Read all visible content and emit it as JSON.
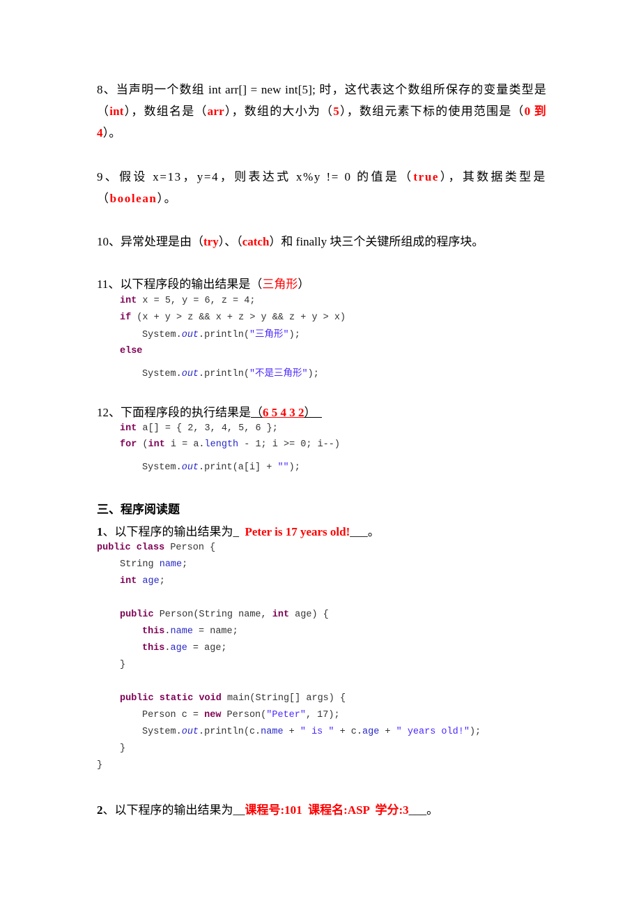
{
  "colors": {
    "answer": "#ff0000",
    "keyword": "#7f0055",
    "field": "#0000c0",
    "string": "#2a00ff"
  },
  "q8": {
    "text1": "8、当声明一个数组 int arr[] = new int[5]; 时，这代表这个数组所保存的变量类型是（",
    "ans1": "int",
    "text2": "），数组名是（",
    "ans2": "arr",
    "text3": "），数组的大小为（",
    "ans3": "5",
    "text4": "），数组元素下标的使用范围是（",
    "ans4": "0 到 4",
    "text5": "）。"
  },
  "q9": {
    "text1": "9、假设 x=13，y=4，则表达式 x%y != 0 的值是（",
    "ans1": "true",
    "text2": "），其数据类型是（",
    "ans2": "boolean",
    "text3": "）。"
  },
  "q10": {
    "text1": "10、异常处理是由（",
    "ans1": "try",
    "text2": "）、（",
    "ans2": "catch",
    "text3": "）和 finally 块三个关键所组成的程序块。"
  },
  "q11": {
    "text1": "11、以下程序段的输出结果是（",
    "ans1": "三角形",
    "text2": "）",
    "code": {
      "l1_kw": "int",
      "l1_rest": " x = 5, y = 6, z = 4;",
      "l2_kw": "if",
      "l2_rest": " (x + y > z && x + z > y && z + y > x)",
      "l3_a": "System.",
      "l3_out": "out",
      "l3_b": ".println(",
      "l3_str": "\"三角形\"",
      "l3_c": ");",
      "l4_kw": "else",
      "l5_a": "System.",
      "l5_out": "out",
      "l5_b": ".println(",
      "l5_str": "\"不是三角形\"",
      "l5_c": ");"
    }
  },
  "q12": {
    "text1": "12、下面程序段的执行结果是",
    "paren_open": "（",
    "ans1": "6 5 4 3 2",
    "paren_close": "）",
    "code": {
      "l1_kw": "int",
      "l1_rest": " a[] = { 2, 3, 4, 5, 6 };",
      "l2_kw1": "for",
      "l2_a": " (",
      "l2_kw2": "int",
      "l2_b": " i = a.",
      "l2_fld": "length",
      "l2_c": " - 1; i >= 0; i--)",
      "l3_a": "System.",
      "l3_out": "out",
      "l3_b": ".print(a[i] + ",
      "l3_str": "\"\"",
      "l3_c": ");"
    }
  },
  "section3": {
    "heading": "三、程序阅读题",
    "q1": {
      "num": "1",
      "text1": "、以下程序的输出结果为_  ",
      "ans1": "Peter is 17 years old!",
      "text2": "___。",
      "code": {
        "l1_kw1": "public",
        "l1_sp": " ",
        "l1_kw2": "class",
        "l1_rest": " Person {",
        "l2_a": "String ",
        "l2_fld": "name",
        "l2_b": ";",
        "l3_kw": "int",
        "l3_sp": " ",
        "l3_fld": "age",
        "l3_b": ";",
        "l4_kw1": "public",
        "l4_a": " Person(String name, ",
        "l4_kw2": "int",
        "l4_b": " age) {",
        "l5_kw": "this",
        "l5_a": ".",
        "l5_fld": "name",
        "l5_b": " = name;",
        "l6_kw": "this",
        "l6_a": ".",
        "l6_fld": "age",
        "l6_b": " = age;",
        "l7": "}",
        "l8_kw1": "public",
        "l8_sp1": " ",
        "l8_kw2": "static",
        "l8_sp2": " ",
        "l8_kw3": "void",
        "l8_rest": " main(String[] args) {",
        "l9_a": "Person c = ",
        "l9_kw": "new",
        "l9_b": " Person(",
        "l9_str": "\"Peter\"",
        "l9_c": ", 17);",
        "l10_a": "System.",
        "l10_out": "out",
        "l10_b": ".println(c.",
        "l10_fld1": "name",
        "l10_c": " + ",
        "l10_str1": "\" is \"",
        "l10_d": " + c.",
        "l10_fld2": "age",
        "l10_e": " + ",
        "l10_str2": "\" years old!\"",
        "l10_f": ");",
        "l11": "}",
        "l12": "}"
      }
    },
    "q2": {
      "num": "2",
      "text1": "、以下程序的输出结果为__",
      "ans1": "课程号:101  课程名:ASP  学分:3",
      "text2": "___。"
    }
  }
}
